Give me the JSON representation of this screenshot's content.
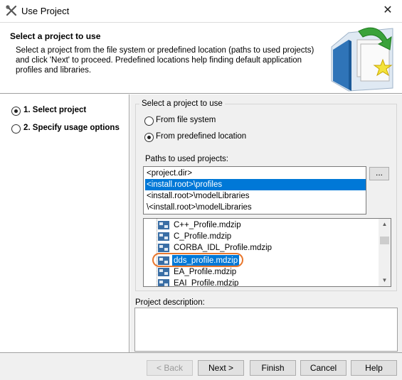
{
  "window": {
    "title": "Use Project",
    "close_glyph": "✕",
    "app_icon": "wrench-x-icon"
  },
  "header": {
    "title": "Select a project to use",
    "description": "Select a project from the file system or predefined location (paths to used projects) and click 'Next' to proceed. Predefined locations help finding default application profiles and libraries.",
    "graphic": "project-folder-arrow-star-icon"
  },
  "nav": {
    "steps": [
      {
        "label": "1. Select project",
        "selected": true
      },
      {
        "label": "2. Specify usage options",
        "selected": false
      }
    ]
  },
  "source_group": {
    "title": "Select a project to use",
    "options": [
      {
        "label": "From file system",
        "selected": false
      },
      {
        "label": "From predefined location",
        "selected": true
      }
    ]
  },
  "paths": {
    "label": "Paths to used projects:",
    "items": [
      "<project.dir>",
      "<install.root>\\profiles",
      "<install.root>\\modelLibraries",
      "\\<install.root>\\modelLibraries"
    ],
    "selected_index": 1,
    "browse_label": "..."
  },
  "files": {
    "items": [
      "C++_Profile.mdzip",
      "C_Profile.mdzip",
      "CORBA_IDL_Profile.mdzip",
      "dds_profile.mdzip",
      "EA_Profile.mdzip",
      "EAI_Profile.mdzip"
    ],
    "selected_index": 3,
    "icon": "model-file-icon"
  },
  "project_description": {
    "label": "Project description:",
    "value": ""
  },
  "buttons": {
    "back": "< Back",
    "next": "Next >",
    "finish": "Finish",
    "cancel": "Cancel",
    "help": "Help"
  },
  "colors": {
    "selection": "#0078d7",
    "highlight_ring": "#e8772e",
    "panel": "#f0f0f0"
  }
}
